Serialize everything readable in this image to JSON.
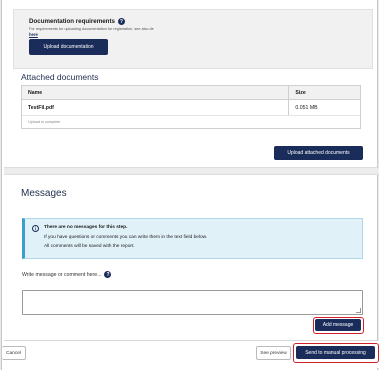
{
  "documentation": {
    "title": "Documentation requirements",
    "help_icon": "question-circle-icon",
    "description": "For requirements for uploading documentation for registration, see also de",
    "link_text": "here",
    "upload_label": "Upload documentation"
  },
  "attached": {
    "heading": "Attached documents",
    "columns": [
      "Name",
      "Size"
    ],
    "rows": [
      {
        "name": "TestFil.pdf",
        "size": "0.051 MB"
      }
    ],
    "status_note": "Upload is complete",
    "upload_label": "Upload attached documents"
  },
  "messages": {
    "heading": "Messages",
    "info_icon": "info-circle-icon",
    "info_title": "There are no messages for this step.",
    "info_line1": "If you have questions or comments you can write them in the text field below.",
    "info_line2": "All comments will be saved with the report.",
    "input_label": "Write message or comment here...",
    "input_placeholder": "",
    "add_label": "Add message"
  },
  "footer": {
    "cancel_label": "Cancel",
    "preview_label": "See preview",
    "send_label": "Send to manual processing"
  },
  "colors": {
    "primary": "#1a2d5a",
    "highlight": "#d0202a",
    "info_bg": "#e0f1f8"
  }
}
